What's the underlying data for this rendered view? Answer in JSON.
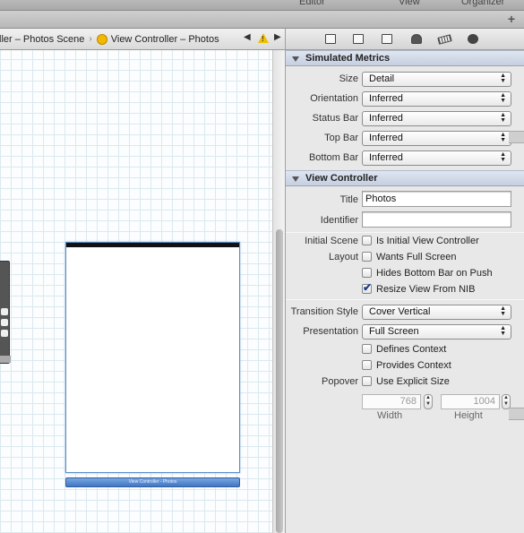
{
  "toolbar": {
    "editor_label": "Editor",
    "view_label": "View",
    "organizer_label": "Organizer"
  },
  "tabstrip": {
    "add_tab_label": "+"
  },
  "jumpbar": {
    "crumb_scene": "ller – Photos Scene",
    "crumb_controller": "View Controller – Photos",
    "separator": "›",
    "back_arrow": "◀",
    "forward_arrow": "▶"
  },
  "canvas": {
    "scene_dock_label": "View Controller - Photos"
  },
  "simulated_metrics": {
    "header": "Simulated Metrics",
    "size_label": "Size",
    "size_value": "Detail",
    "orientation_label": "Orientation",
    "orientation_value": "Inferred",
    "status_bar_label": "Status Bar",
    "status_bar_value": "Inferred",
    "top_bar_label": "Top Bar",
    "top_bar_value": "Inferred",
    "bottom_bar_label": "Bottom Bar",
    "bottom_bar_value": "Inferred"
  },
  "view_controller": {
    "header": "View Controller",
    "title_label": "Title",
    "title_value": "Photos",
    "identifier_label": "Identifier",
    "identifier_value": "",
    "initial_scene_label": "Initial Scene",
    "is_initial_label": "Is Initial View Controller",
    "is_initial_checked": false,
    "layout_label": "Layout",
    "wants_full_screen_label": "Wants Full Screen",
    "wants_full_screen_checked": false,
    "hides_bottom_bar_label": "Hides Bottom Bar on Push",
    "hides_bottom_bar_checked": false,
    "resize_view_label": "Resize View From NIB",
    "resize_view_checked": true,
    "transition_style_label": "Transition Style",
    "transition_style_value": "Cover Vertical",
    "presentation_label": "Presentation",
    "presentation_value": "Full Screen",
    "defines_context_label": "Defines Context",
    "defines_context_checked": false,
    "provides_context_label": "Provides Context",
    "provides_context_checked": false,
    "popover_label": "Popover",
    "explicit_size_label": "Use Explicit Size",
    "explicit_size_checked": false,
    "width_value": "768",
    "height_value": "1004",
    "width_label": "Width",
    "height_label": "Height"
  },
  "colors": {
    "section_header": "#c9d3e3",
    "selection_blue": "#5b8ec9",
    "warning": "#f0c000"
  }
}
